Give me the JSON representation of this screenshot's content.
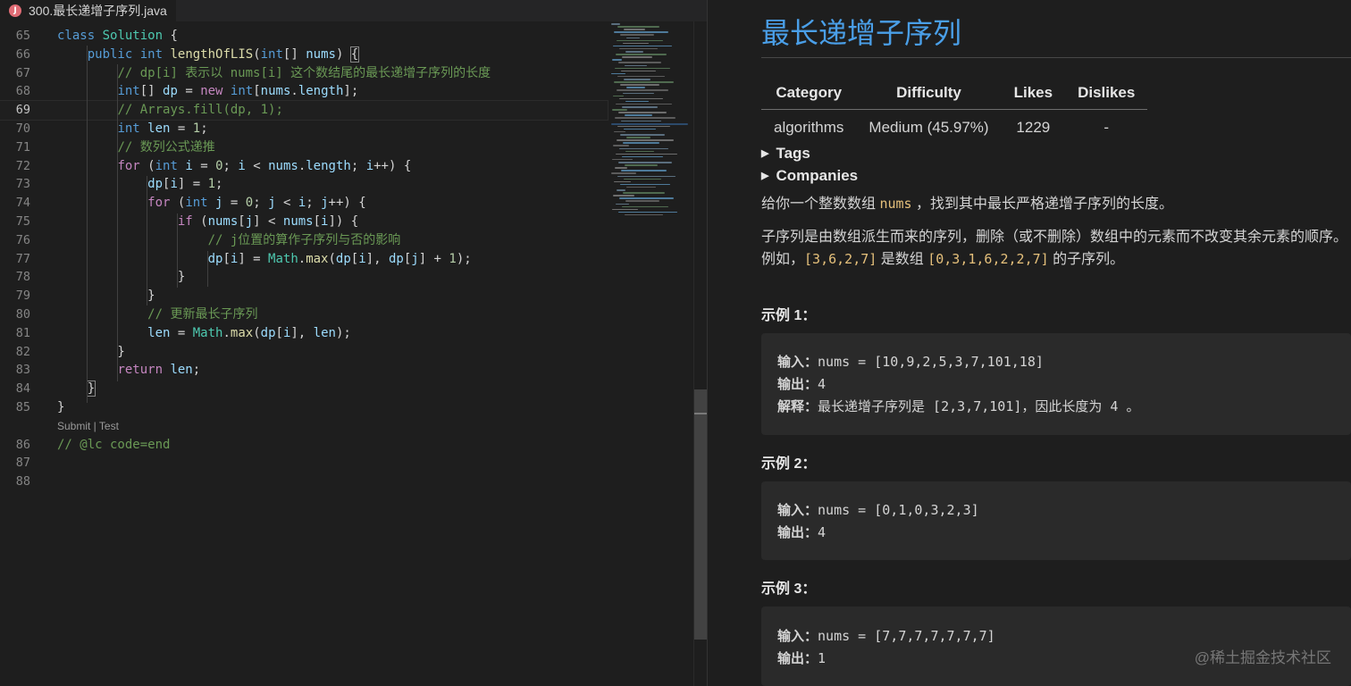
{
  "editor": {
    "tab_icon": "J",
    "tab_title": "300.最长递增子序列.java",
    "codelens": "Submit | Test",
    "lines": [
      {
        "n": "65",
        "tokens": [
          [
            "k",
            "class"
          ],
          [
            "p",
            " "
          ],
          [
            "t",
            "Solution"
          ],
          [
            "p",
            " {"
          ]
        ]
      },
      {
        "n": "66",
        "tokens": [
          [
            "p",
            "    "
          ],
          [
            "k",
            "public"
          ],
          [
            "p",
            " "
          ],
          [
            "k",
            "int"
          ],
          [
            "p",
            " "
          ],
          [
            "f",
            "lengthOfLIS"
          ],
          [
            "p",
            "("
          ],
          [
            "k",
            "int"
          ],
          [
            "p",
            "[] "
          ],
          [
            "v",
            "nums"
          ],
          [
            "p",
            ") "
          ],
          [
            "bx",
            "{"
          ]
        ]
      },
      {
        "n": "67",
        "tokens": [
          [
            "p",
            "        "
          ],
          [
            "c",
            "// dp[i] 表示以 nums[i] 这个数结尾的最长递增子序列的长度"
          ]
        ]
      },
      {
        "n": "68",
        "tokens": [
          [
            "p",
            "        "
          ],
          [
            "k",
            "int"
          ],
          [
            "p",
            "[] "
          ],
          [
            "v",
            "dp"
          ],
          [
            "p",
            " = "
          ],
          [
            "kw",
            "new"
          ],
          [
            "p",
            " "
          ],
          [
            "k",
            "int"
          ],
          [
            "p",
            "["
          ],
          [
            "v",
            "nums"
          ],
          [
            "p",
            "."
          ],
          [
            "v",
            "length"
          ],
          [
            "p",
            "];"
          ]
        ]
      },
      {
        "n": "69",
        "cur": true,
        "tokens": [
          [
            "p",
            "        "
          ],
          [
            "c",
            "// Arrays.fill(dp, 1);"
          ]
        ]
      },
      {
        "n": "70",
        "tokens": [
          [
            "p",
            "        "
          ],
          [
            "k",
            "int"
          ],
          [
            "p",
            " "
          ],
          [
            "v",
            "len"
          ],
          [
            "p",
            " = "
          ],
          [
            "n",
            "1"
          ],
          [
            "p",
            ";"
          ]
        ]
      },
      {
        "n": "71",
        "tokens": [
          [
            "p",
            "        "
          ],
          [
            "c",
            "// 数列公式递推"
          ]
        ]
      },
      {
        "n": "72",
        "tokens": [
          [
            "p",
            "        "
          ],
          [
            "kw",
            "for"
          ],
          [
            "p",
            " ("
          ],
          [
            "k",
            "int"
          ],
          [
            "p",
            " "
          ],
          [
            "v",
            "i"
          ],
          [
            "p",
            " = "
          ],
          [
            "n",
            "0"
          ],
          [
            "p",
            "; "
          ],
          [
            "v",
            "i"
          ],
          [
            "p",
            " < "
          ],
          [
            "v",
            "nums"
          ],
          [
            "p",
            "."
          ],
          [
            "v",
            "length"
          ],
          [
            "p",
            "; "
          ],
          [
            "v",
            "i"
          ],
          [
            "p",
            "++) {"
          ]
        ]
      },
      {
        "n": "73",
        "tokens": [
          [
            "p",
            "            "
          ],
          [
            "v",
            "dp"
          ],
          [
            "p",
            "["
          ],
          [
            "v",
            "i"
          ],
          [
            "p",
            "] = "
          ],
          [
            "n",
            "1"
          ],
          [
            "p",
            ";"
          ]
        ]
      },
      {
        "n": "74",
        "tokens": [
          [
            "p",
            "            "
          ],
          [
            "kw",
            "for"
          ],
          [
            "p",
            " ("
          ],
          [
            "k",
            "int"
          ],
          [
            "p",
            " "
          ],
          [
            "v",
            "j"
          ],
          [
            "p",
            " = "
          ],
          [
            "n",
            "0"
          ],
          [
            "p",
            "; "
          ],
          [
            "v",
            "j"
          ],
          [
            "p",
            " < "
          ],
          [
            "v",
            "i"
          ],
          [
            "p",
            "; "
          ],
          [
            "v",
            "j"
          ],
          [
            "p",
            "++) {"
          ]
        ]
      },
      {
        "n": "75",
        "tokens": [
          [
            "p",
            "                "
          ],
          [
            "kw",
            "if"
          ],
          [
            "p",
            " ("
          ],
          [
            "v",
            "nums"
          ],
          [
            "p",
            "["
          ],
          [
            "v",
            "j"
          ],
          [
            "p",
            "] < "
          ],
          [
            "v",
            "nums"
          ],
          [
            "p",
            "["
          ],
          [
            "v",
            "i"
          ],
          [
            "p",
            "]) {"
          ]
        ]
      },
      {
        "n": "76",
        "tokens": [
          [
            "p",
            "                    "
          ],
          [
            "c",
            "// j位置的算作子序列与否的影响"
          ]
        ]
      },
      {
        "n": "77",
        "tokens": [
          [
            "p",
            "                    "
          ],
          [
            "v",
            "dp"
          ],
          [
            "p",
            "["
          ],
          [
            "v",
            "i"
          ],
          [
            "p",
            "] = "
          ],
          [
            "t",
            "Math"
          ],
          [
            "p",
            "."
          ],
          [
            "f",
            "max"
          ],
          [
            "p",
            "("
          ],
          [
            "v",
            "dp"
          ],
          [
            "p",
            "["
          ],
          [
            "v",
            "i"
          ],
          [
            "p",
            "], "
          ],
          [
            "v",
            "dp"
          ],
          [
            "p",
            "["
          ],
          [
            "v",
            "j"
          ],
          [
            "p",
            "] + "
          ],
          [
            "n",
            "1"
          ],
          [
            "p",
            ");"
          ]
        ]
      },
      {
        "n": "78",
        "tokens": [
          [
            "p",
            "                }"
          ]
        ]
      },
      {
        "n": "79",
        "tokens": [
          [
            "p",
            "            }"
          ]
        ]
      },
      {
        "n": "80",
        "tokens": [
          [
            "p",
            "            "
          ],
          [
            "c",
            "// 更新最长子序列"
          ]
        ]
      },
      {
        "n": "81",
        "tokens": [
          [
            "p",
            "            "
          ],
          [
            "v",
            "len"
          ],
          [
            "p",
            " = "
          ],
          [
            "t",
            "Math"
          ],
          [
            "p",
            "."
          ],
          [
            "f",
            "max"
          ],
          [
            "p",
            "("
          ],
          [
            "v",
            "dp"
          ],
          [
            "p",
            "["
          ],
          [
            "v",
            "i"
          ],
          [
            "p",
            "], "
          ],
          [
            "v",
            "len"
          ],
          [
            "p",
            ");"
          ]
        ]
      },
      {
        "n": "82",
        "tokens": [
          [
            "p",
            "        }"
          ]
        ]
      },
      {
        "n": "83",
        "tokens": [
          [
            "p",
            "        "
          ],
          [
            "kw",
            "return"
          ],
          [
            "p",
            " "
          ],
          [
            "v",
            "len"
          ],
          [
            "p",
            ";"
          ]
        ]
      },
      {
        "n": "84",
        "tokens": [
          [
            "p",
            "    "
          ],
          [
            "bx",
            "}"
          ]
        ]
      },
      {
        "n": "85",
        "tokens": [
          [
            "p",
            "}"
          ]
        ]
      },
      {
        "lens": true
      },
      {
        "n": "86",
        "tokens": [
          [
            "c",
            "// @lc code=end"
          ]
        ]
      },
      {
        "n": "87",
        "tokens": []
      },
      {
        "n": "88",
        "tokens": []
      }
    ]
  },
  "problem": {
    "title": "最长递增子序列",
    "table": {
      "headers": [
        "Category",
        "Difficulty",
        "Likes",
        "Dislikes"
      ],
      "row": [
        "algorithms",
        "Medium (45.97%)",
        "1229",
        "-"
      ]
    },
    "tags_label": "Tags",
    "companies_label": "Companies",
    "desc1_a": "给你一个整数数组 ",
    "desc1_code": "nums",
    "desc1_b": " ，找到其中最长严格递增子序列的长度。",
    "desc2": "子序列是由数组派生而来的序列，删除（或不删除）数组中的元素而不改变其余元素的顺序。",
    "desc3_a": "例如，",
    "desc3_code1": "[3,6,2,7]",
    "desc3_b": " 是数组 ",
    "desc3_code2": "[0,3,1,6,2,2,7]",
    "desc3_c": " 的子序列。",
    "examples": [
      {
        "heading": "示例 1：",
        "in_label": "输入：",
        "input": "nums = [10,9,2,5,3,7,101,18]",
        "out_label": "输出：",
        "output": "4",
        "exp_label": "解释：",
        "explain": "最长递增子序列是 [2,3,7,101]，因此长度为 4 。"
      },
      {
        "heading": "示例 2：",
        "in_label": "输入：",
        "input": "nums = [0,1,0,3,2,3]",
        "out_label": "输出：",
        "output": "4"
      },
      {
        "heading": "示例 3：",
        "in_label": "输入：",
        "input": "nums = [7,7,7,7,7,7,7]",
        "out_label": "输出：",
        "output": "1"
      }
    ]
  },
  "watermark": "@稀土掘金技术社区"
}
